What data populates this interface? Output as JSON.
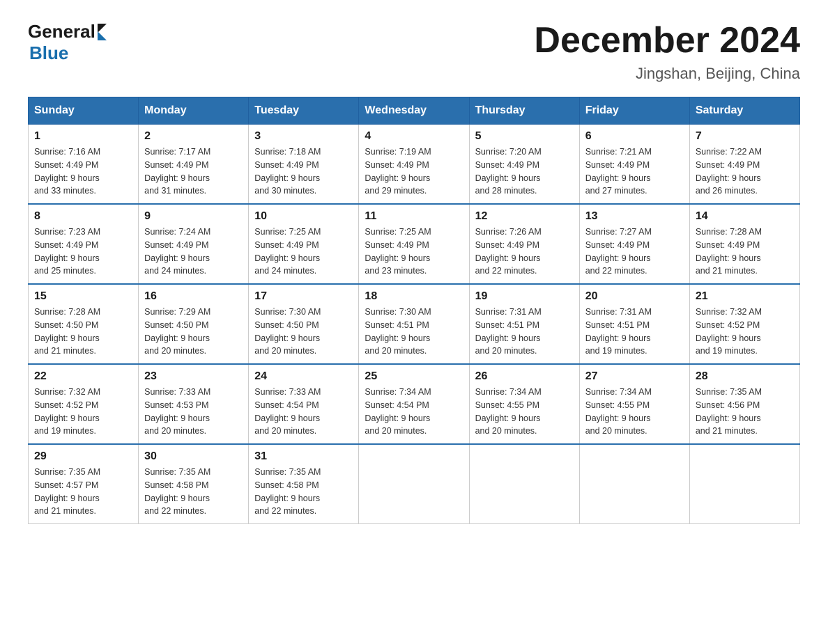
{
  "header": {
    "logo_general": "General",
    "logo_blue": "Blue",
    "title": "December 2024",
    "location": "Jingshan, Beijing, China"
  },
  "calendar": {
    "days_of_week": [
      "Sunday",
      "Monday",
      "Tuesday",
      "Wednesday",
      "Thursday",
      "Friday",
      "Saturday"
    ],
    "weeks": [
      [
        {
          "day": "1",
          "sunrise": "7:16 AM",
          "sunset": "4:49 PM",
          "daylight": "9 hours and 33 minutes."
        },
        {
          "day": "2",
          "sunrise": "7:17 AM",
          "sunset": "4:49 PM",
          "daylight": "9 hours and 31 minutes."
        },
        {
          "day": "3",
          "sunrise": "7:18 AM",
          "sunset": "4:49 PM",
          "daylight": "9 hours and 30 minutes."
        },
        {
          "day": "4",
          "sunrise": "7:19 AM",
          "sunset": "4:49 PM",
          "daylight": "9 hours and 29 minutes."
        },
        {
          "day": "5",
          "sunrise": "7:20 AM",
          "sunset": "4:49 PM",
          "daylight": "9 hours and 28 minutes."
        },
        {
          "day": "6",
          "sunrise": "7:21 AM",
          "sunset": "4:49 PM",
          "daylight": "9 hours and 27 minutes."
        },
        {
          "day": "7",
          "sunrise": "7:22 AM",
          "sunset": "4:49 PM",
          "daylight": "9 hours and 26 minutes."
        }
      ],
      [
        {
          "day": "8",
          "sunrise": "7:23 AM",
          "sunset": "4:49 PM",
          "daylight": "9 hours and 25 minutes."
        },
        {
          "day": "9",
          "sunrise": "7:24 AM",
          "sunset": "4:49 PM",
          "daylight": "9 hours and 24 minutes."
        },
        {
          "day": "10",
          "sunrise": "7:25 AM",
          "sunset": "4:49 PM",
          "daylight": "9 hours and 24 minutes."
        },
        {
          "day": "11",
          "sunrise": "7:25 AM",
          "sunset": "4:49 PM",
          "daylight": "9 hours and 23 minutes."
        },
        {
          "day": "12",
          "sunrise": "7:26 AM",
          "sunset": "4:49 PM",
          "daylight": "9 hours and 22 minutes."
        },
        {
          "day": "13",
          "sunrise": "7:27 AM",
          "sunset": "4:49 PM",
          "daylight": "9 hours and 22 minutes."
        },
        {
          "day": "14",
          "sunrise": "7:28 AM",
          "sunset": "4:49 PM",
          "daylight": "9 hours and 21 minutes."
        }
      ],
      [
        {
          "day": "15",
          "sunrise": "7:28 AM",
          "sunset": "4:50 PM",
          "daylight": "9 hours and 21 minutes."
        },
        {
          "day": "16",
          "sunrise": "7:29 AM",
          "sunset": "4:50 PM",
          "daylight": "9 hours and 20 minutes."
        },
        {
          "day": "17",
          "sunrise": "7:30 AM",
          "sunset": "4:50 PM",
          "daylight": "9 hours and 20 minutes."
        },
        {
          "day": "18",
          "sunrise": "7:30 AM",
          "sunset": "4:51 PM",
          "daylight": "9 hours and 20 minutes."
        },
        {
          "day": "19",
          "sunrise": "7:31 AM",
          "sunset": "4:51 PM",
          "daylight": "9 hours and 20 minutes."
        },
        {
          "day": "20",
          "sunrise": "7:31 AM",
          "sunset": "4:51 PM",
          "daylight": "9 hours and 19 minutes."
        },
        {
          "day": "21",
          "sunrise": "7:32 AM",
          "sunset": "4:52 PM",
          "daylight": "9 hours and 19 minutes."
        }
      ],
      [
        {
          "day": "22",
          "sunrise": "7:32 AM",
          "sunset": "4:52 PM",
          "daylight": "9 hours and 19 minutes."
        },
        {
          "day": "23",
          "sunrise": "7:33 AM",
          "sunset": "4:53 PM",
          "daylight": "9 hours and 20 minutes."
        },
        {
          "day": "24",
          "sunrise": "7:33 AM",
          "sunset": "4:54 PM",
          "daylight": "9 hours and 20 minutes."
        },
        {
          "day": "25",
          "sunrise": "7:34 AM",
          "sunset": "4:54 PM",
          "daylight": "9 hours and 20 minutes."
        },
        {
          "day": "26",
          "sunrise": "7:34 AM",
          "sunset": "4:55 PM",
          "daylight": "9 hours and 20 minutes."
        },
        {
          "day": "27",
          "sunrise": "7:34 AM",
          "sunset": "4:55 PM",
          "daylight": "9 hours and 20 minutes."
        },
        {
          "day": "28",
          "sunrise": "7:35 AM",
          "sunset": "4:56 PM",
          "daylight": "9 hours and 21 minutes."
        }
      ],
      [
        {
          "day": "29",
          "sunrise": "7:35 AM",
          "sunset": "4:57 PM",
          "daylight": "9 hours and 21 minutes."
        },
        {
          "day": "30",
          "sunrise": "7:35 AM",
          "sunset": "4:58 PM",
          "daylight": "9 hours and 22 minutes."
        },
        {
          "day": "31",
          "sunrise": "7:35 AM",
          "sunset": "4:58 PM",
          "daylight": "9 hours and 22 minutes."
        },
        null,
        null,
        null,
        null
      ]
    ]
  }
}
